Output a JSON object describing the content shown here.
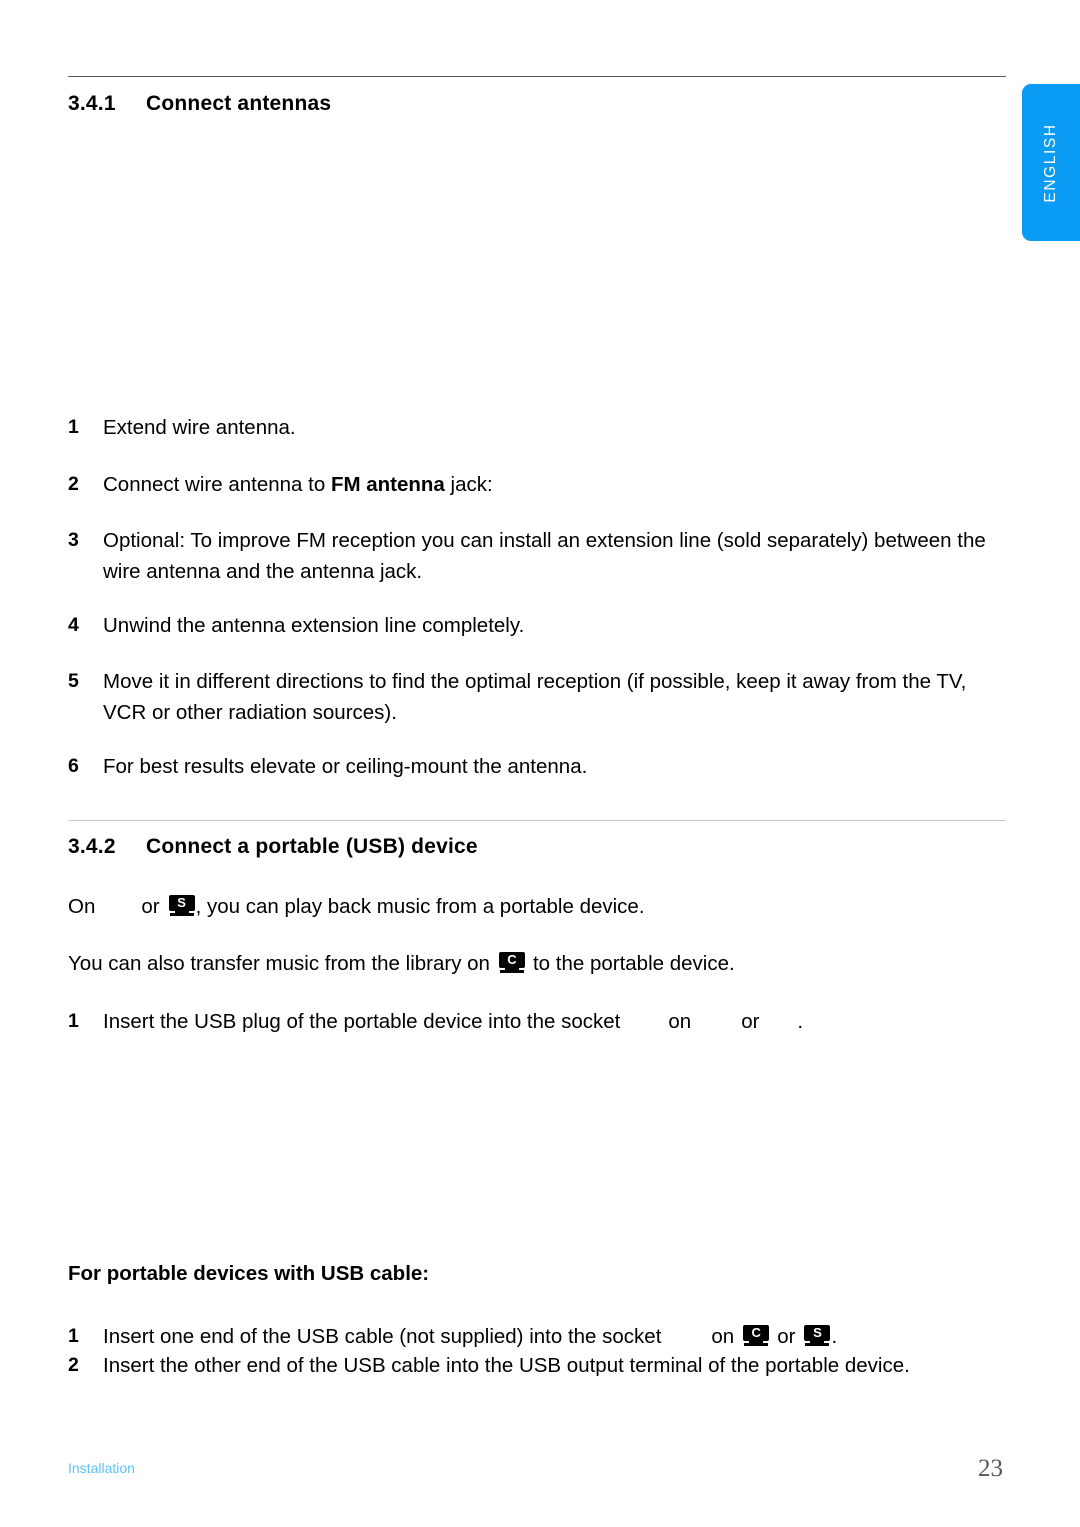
{
  "document": {
    "language_tab": "ENGLISH",
    "footer": {
      "section_label": "Installation",
      "page_number": "23"
    },
    "colors": {
      "tab_blue": "#0a9bf5",
      "footer_blue": "#5cc3f7",
      "rule_dark": "#595959",
      "rule_light": "#c8c8c8",
      "page_number_gray": "#58585a"
    }
  },
  "sections": [
    {
      "number": "3.4.1",
      "title": "Connect antennas",
      "steps": [
        {
          "num": "1",
          "text": "Extend wire antenna."
        },
        {
          "num": "2",
          "text_before": "Connect wire antenna to ",
          "bold": "FM antenna",
          "text_after": " jack:"
        },
        {
          "num": "3",
          "text": "Optional: To improve FM reception you can install an extension line (sold separately) between the wire antenna and the antenna jack."
        },
        {
          "num": "4",
          "text": "Unwind the antenna extension line completely."
        },
        {
          "num": "5",
          "text": "Move it in different directions to find the optimal reception (if possible, keep it away from the TV, VCR or other radiation sources)."
        },
        {
          "num": "6",
          "text": "For best results elevate or ceiling-mount the antenna."
        }
      ]
    },
    {
      "number": "3.4.2",
      "title": "Connect a portable (USB) device",
      "intro_1": {
        "part_1": "On",
        "part_2": "or",
        "badge": "S",
        "part_3": ", you can play back music from a portable device."
      },
      "intro_2": {
        "part_1": "You can also transfer music from the library on",
        "badge": "C",
        "part_2": "to the portable device."
      },
      "steps": [
        {
          "num": "1",
          "part_1": "Insert the USB plug of the portable device into the socket",
          "part_2": "on",
          "part_3": "or",
          "part_4": "."
        }
      ],
      "subheading": "For portable devices with USB cable:",
      "cable_steps": [
        {
          "num": "1",
          "part_1": "Insert one end of the USB cable (not supplied) into the socket",
          "part_2": "on",
          "badge_1": "C",
          "part_3": "or",
          "badge_2": "S",
          "part_4": "."
        },
        {
          "num": "2",
          "text": "Insert the other end of the USB cable into the USB output terminal of the portable device."
        }
      ]
    }
  ]
}
